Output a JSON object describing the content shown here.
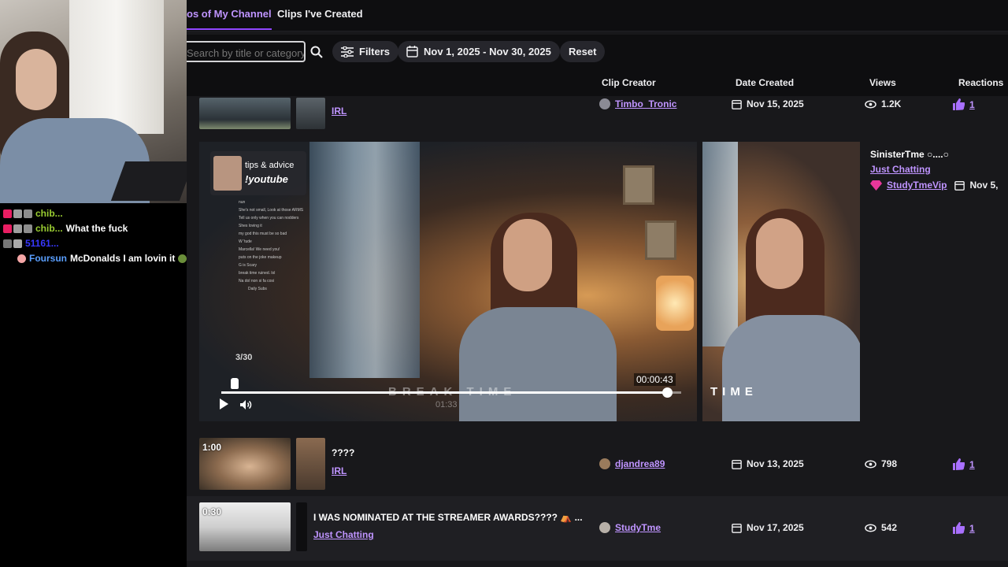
{
  "chat": [
    {
      "name": "chib...",
      "message": "",
      "color": "#9acd32"
    },
    {
      "name": "chib...",
      "message": "What the fuck",
      "color": "#9acd32"
    },
    {
      "name": "51161...",
      "message": "",
      "color": "#3838ff"
    },
    {
      "name": "Foursun",
      "message": "McDonalds I am lovin it",
      "color": "#5a9fff"
    }
  ],
  "tabs": {
    "active": "os of My Channel",
    "inactive": "Clips I've Created"
  },
  "toolbar": {
    "search_placeholder": "Search by title or category",
    "filters_label": "Filters",
    "date_range_label": "Nov 1, 2025 - Nov 30, 2025",
    "reset_label": "Reset"
  },
  "columns": {
    "creator": "Clip Creator",
    "date": "Date Created",
    "views": "Views",
    "reactions": "Reactions"
  },
  "rows": [
    {
      "title": "",
      "category": "IRL",
      "creator": "Timbo_Tronic",
      "date": "Nov 15, 2025",
      "views": "1.2K",
      "reactions": "1",
      "duration": ""
    },
    {
      "title": "????",
      "category": "IRL",
      "creator": "djandrea89",
      "date": "Nov 13, 2025",
      "views": "798",
      "reactions": "1",
      "duration": "1:00"
    },
    {
      "title": "I WAS NOMINATED AT THE STREAMER AWARDS???? ⛺ ...",
      "category": "Just Chatting",
      "creator": "StudyTme",
      "date": "Nov 17, 2025",
      "views": "542",
      "reactions": "1",
      "duration": "0:30"
    }
  ],
  "expanded": {
    "title": "SinisterTme ○....○",
    "category": "Just Chatting",
    "creator": "StudyTmeVip",
    "date": "Nov 5,",
    "preview": {
      "card_line1": "tips & advice",
      "card_line2": "!youtube",
      "count": "3/30",
      "current_time": "00:00:43",
      "break_text": "BREAK TIME",
      "sub_time": "01:33",
      "side_text": "TIME",
      "progress": 0.97,
      "chat_lines": [
        "nun",
        "She's not small, Look at those ARMS",
        "Tell us only when you can nodders",
        "Shes loving it",
        "my god this must be so bad",
        "W 'tude",
        "Marcella! We need you!",
        "puts on the joke makeup",
        "G is Scary",
        "break time ruined. lol",
        "Na dol non si fa cosi",
        "Daily Subs"
      ]
    }
  }
}
